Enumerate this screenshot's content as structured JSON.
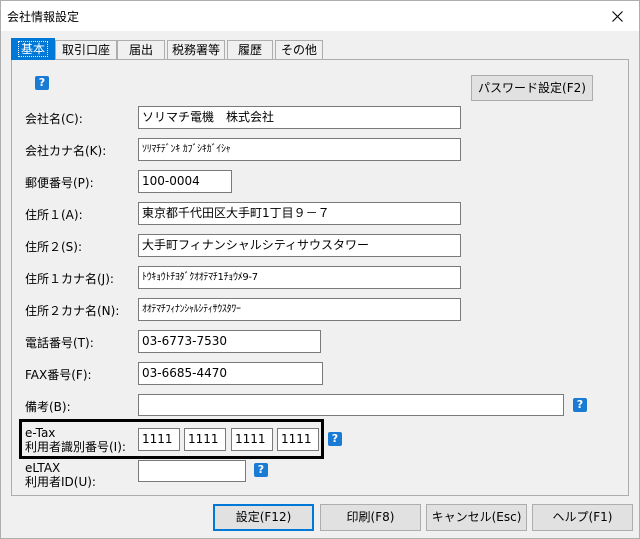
{
  "window": {
    "title": "会社情報設定"
  },
  "tabs": [
    {
      "label": "基本"
    },
    {
      "label": "取引口座"
    },
    {
      "label": "届出"
    },
    {
      "label": "税務署等"
    },
    {
      "label": "履歴"
    },
    {
      "label": "その他"
    }
  ],
  "help": {
    "glyph": "?"
  },
  "password_button": "パスワード設定(F2)",
  "form": {
    "company_name": {
      "label": "会社名(C):",
      "value": "ソリマチ電機　株式会社"
    },
    "company_kana": {
      "label": "会社カナ名(K):",
      "value": "ｿﾘﾏﾁﾃﾞﾝｷ ｶﾌﾞｼｷｶﾞｲｼｬ"
    },
    "postal": {
      "label": "郵便番号(P):",
      "value": "100-0004"
    },
    "address1": {
      "label": "住所１(A):",
      "value": "東京都千代田区大手町1丁目９－７"
    },
    "address2": {
      "label": "住所２(S):",
      "value": "大手町フィナンシャルシティサウスタワー"
    },
    "address1_kana": {
      "label": "住所１カナ名(J):",
      "value": "ﾄｳｷｮｳﾄﾁﾖﾀﾞｸｵｵﾃﾏﾁ1ﾁｮｳﾒ9-7"
    },
    "address2_kana": {
      "label": "住所２カナ名(N):",
      "value": "ｵｵﾃﾏﾁﾌｨﾅﾝｼｬﾙｼﾃｨｻｳｽﾀﾜｰ"
    },
    "phone": {
      "label": "電話番号(T):",
      "value": "03-6773-7530"
    },
    "fax": {
      "label": "FAX番号(F):",
      "value": "03-6685-4470"
    },
    "notes": {
      "label": "備考(B):",
      "value": ""
    },
    "etax": {
      "label_line1": "e-Tax",
      "label_line2": "利用者識別番号(I):",
      "values": [
        "1111",
        "1111",
        "1111",
        "1111"
      ]
    },
    "eltax": {
      "label_line1": "eLTAX",
      "label_line2": "利用者ID(U):",
      "value": ""
    }
  },
  "buttons": {
    "settings": "設定(F12)",
    "print": "印刷(F8)",
    "cancel": "キャンセル(Esc)",
    "help": "ヘルプ(F1)"
  },
  "colors": {
    "tab_active": "#0078d7",
    "help_icon": "#1a7bd5",
    "button_bg": "#e1e1e1",
    "window_bg": "#f0f0f0"
  }
}
